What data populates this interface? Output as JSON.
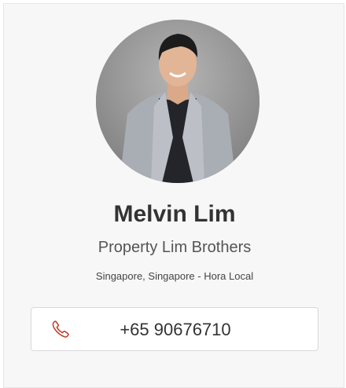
{
  "profile": {
    "name": "Melvin Lim",
    "company": "Property Lim Brothers",
    "location": "Singapore, Singapore - Hora Local"
  },
  "contact": {
    "phone": "+65 90676710",
    "phone_icon": "phone-icon"
  },
  "colors": {
    "accent": "#c0392b",
    "card_bg": "#f7f7f7",
    "text": "#333333"
  }
}
